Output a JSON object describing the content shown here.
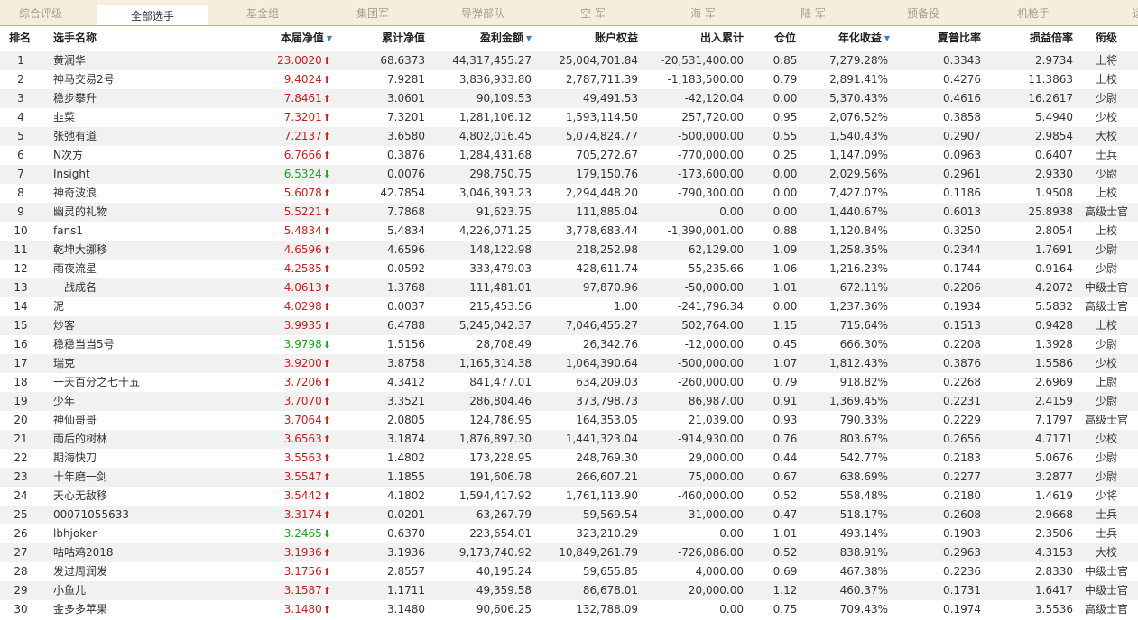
{
  "tabs": [
    {
      "label": "综合评级",
      "active": false
    },
    {
      "label": "全部选手",
      "active": true
    },
    {
      "label": "基金组",
      "active": false
    },
    {
      "label": "集团军",
      "active": false
    },
    {
      "label": "导弹部队",
      "active": false
    },
    {
      "label": "空  军",
      "active": false
    },
    {
      "label": "海  军",
      "active": false
    },
    {
      "label": "陆  军",
      "active": false
    },
    {
      "label": "预备役",
      "active": false
    },
    {
      "label": "机枪手",
      "active": false
    },
    {
      "label": "远征",
      "active": false
    }
  ],
  "columns": [
    "排名",
    "选手名称",
    "本届净值",
    "累计净值",
    "盈利金额",
    "账户权益",
    "出入累计",
    "仓位",
    "年化收益",
    "夏普比率",
    "损益倍率",
    "衔级"
  ],
  "sort_icon": "▼",
  "colors": {
    "up": "#c81e1e",
    "down": "#1aa51a",
    "sort": "#3d7ac0"
  },
  "rows": [
    {
      "rank": "1",
      "name": "黄润华",
      "nav": "23.0020",
      "dir": "up",
      "cum": "68.6373",
      "profit": "44,317,455.27",
      "equity": "25,004,701.84",
      "flow": "-20,531,400.00",
      "pos": "0.85",
      "annual": "7,279.28%",
      "sharpe": "0.3343",
      "pl": "2.9734",
      "grade": "上将"
    },
    {
      "rank": "2",
      "name": "神马交易2号",
      "nav": "9.4024",
      "dir": "up",
      "cum": "7.9281",
      "profit": "3,836,933.80",
      "equity": "2,787,711.39",
      "flow": "-1,183,500.00",
      "pos": "0.79",
      "annual": "2,891.41%",
      "sharpe": "0.4276",
      "pl": "11.3863",
      "grade": "上校"
    },
    {
      "rank": "3",
      "name": "稳步攀升",
      "nav": "7.8461",
      "dir": "up",
      "cum": "3.0601",
      "profit": "90,109.53",
      "equity": "49,491.53",
      "flow": "-42,120.04",
      "pos": "0.00",
      "annual": "5,370.43%",
      "sharpe": "0.4616",
      "pl": "16.2617",
      "grade": "少尉"
    },
    {
      "rank": "4",
      "name": "韭菜",
      "nav": "7.3201",
      "dir": "up",
      "cum": "7.3201",
      "profit": "1,281,106.12",
      "equity": "1,593,114.50",
      "flow": "257,720.00",
      "pos": "0.95",
      "annual": "2,076.52%",
      "sharpe": "0.3858",
      "pl": "5.4940",
      "grade": "少校"
    },
    {
      "rank": "5",
      "name": "张弛有道",
      "nav": "7.2137",
      "dir": "up",
      "cum": "3.6580",
      "profit": "4,802,016.45",
      "equity": "5,074,824.77",
      "flow": "-500,000.00",
      "pos": "0.55",
      "annual": "1,540.43%",
      "sharpe": "0.2907",
      "pl": "2.9854",
      "grade": "大校"
    },
    {
      "rank": "6",
      "name": "N次方",
      "nav": "6.7666",
      "dir": "up",
      "cum": "0.3876",
      "profit": "1,284,431.68",
      "equity": "705,272.67",
      "flow": "-770,000.00",
      "pos": "0.25",
      "annual": "1,147.09%",
      "sharpe": "0.0963",
      "pl": "0.6407",
      "grade": "士兵"
    },
    {
      "rank": "7",
      "name": "Insight",
      "nav": "6.5324",
      "dir": "down",
      "cum": "0.0076",
      "profit": "298,750.75",
      "equity": "179,150.76",
      "flow": "-173,600.00",
      "pos": "0.00",
      "annual": "2,029.56%",
      "sharpe": "0.2961",
      "pl": "2.9330",
      "grade": "少尉"
    },
    {
      "rank": "8",
      "name": "神奇波浪",
      "nav": "5.6078",
      "dir": "up",
      "cum": "42.7854",
      "profit": "3,046,393.23",
      "equity": "2,294,448.20",
      "flow": "-790,300.00",
      "pos": "0.00",
      "annual": "7,427.07%",
      "sharpe": "0.1186",
      "pl": "1.9508",
      "grade": "上校"
    },
    {
      "rank": "9",
      "name": "幽灵的礼物",
      "nav": "5.5221",
      "dir": "up",
      "cum": "7.7868",
      "profit": "91,623.75",
      "equity": "111,885.04",
      "flow": "0.00",
      "pos": "0.00",
      "annual": "1,440.67%",
      "sharpe": "0.6013",
      "pl": "25.8938",
      "grade": "高级士官"
    },
    {
      "rank": "10",
      "name": "fans1",
      "nav": "5.4834",
      "dir": "up",
      "cum": "5.4834",
      "profit": "4,226,071.25",
      "equity": "3,778,683.44",
      "flow": "-1,390,001.00",
      "pos": "0.88",
      "annual": "1,120.84%",
      "sharpe": "0.3250",
      "pl": "2.8054",
      "grade": "上校"
    },
    {
      "rank": "11",
      "name": "乾坤大挪移",
      "nav": "4.6596",
      "dir": "up",
      "cum": "4.6596",
      "profit": "148,122.98",
      "equity": "218,252.98",
      "flow": "62,129.00",
      "pos": "1.09",
      "annual": "1,258.35%",
      "sharpe": "0.2344",
      "pl": "1.7691",
      "grade": "少尉"
    },
    {
      "rank": "12",
      "name": "雨夜流星",
      "nav": "4.2585",
      "dir": "up",
      "cum": "0.0592",
      "profit": "333,479.03",
      "equity": "428,611.74",
      "flow": "55,235.66",
      "pos": "1.06",
      "annual": "1,216.23%",
      "sharpe": "0.1744",
      "pl": "0.9164",
      "grade": "少尉"
    },
    {
      "rank": "13",
      "name": "一战成名",
      "nav": "4.0613",
      "dir": "up",
      "cum": "1.3768",
      "profit": "111,481.01",
      "equity": "97,870.96",
      "flow": "-50,000.00",
      "pos": "1.01",
      "annual": "672.11%",
      "sharpe": "0.2206",
      "pl": "4.2072",
      "grade": "中级士官"
    },
    {
      "rank": "14",
      "name": "泥",
      "nav": "4.0298",
      "dir": "up",
      "cum": "0.0037",
      "profit": "215,453.56",
      "equity": "1.00",
      "flow": "-241,796.34",
      "pos": "0.00",
      "annual": "1,237.36%",
      "sharpe": "0.1934",
      "pl": "5.5832",
      "grade": "高级士官"
    },
    {
      "rank": "15",
      "name": "炒客",
      "nav": "3.9935",
      "dir": "up",
      "cum": "6.4788",
      "profit": "5,245,042.37",
      "equity": "7,046,455.27",
      "flow": "502,764.00",
      "pos": "1.15",
      "annual": "715.64%",
      "sharpe": "0.1513",
      "pl": "0.9428",
      "grade": "上校"
    },
    {
      "rank": "16",
      "name": "稳稳当当5号",
      "nav": "3.9798",
      "dir": "down",
      "cum": "1.5156",
      "profit": "28,708.49",
      "equity": "26,342.76",
      "flow": "-12,000.00",
      "pos": "0.45",
      "annual": "666.30%",
      "sharpe": "0.2208",
      "pl": "1.3928",
      "grade": "少尉"
    },
    {
      "rank": "17",
      "name": "瑞克",
      "nav": "3.9200",
      "dir": "up",
      "cum": "3.8758",
      "profit": "1,165,314.38",
      "equity": "1,064,390.64",
      "flow": "-500,000.00",
      "pos": "1.07",
      "annual": "1,812.43%",
      "sharpe": "0.3876",
      "pl": "1.5586",
      "grade": "少校"
    },
    {
      "rank": "18",
      "name": "一天百分之七十五",
      "nav": "3.7206",
      "dir": "up",
      "cum": "4.3412",
      "profit": "841,477.01",
      "equity": "634,209.03",
      "flow": "-260,000.00",
      "pos": "0.79",
      "annual": "918.82%",
      "sharpe": "0.2268",
      "pl": "2.6969",
      "grade": "上尉"
    },
    {
      "rank": "19",
      "name": "少年",
      "nav": "3.7070",
      "dir": "up",
      "cum": "3.3521",
      "profit": "286,804.46",
      "equity": "373,798.73",
      "flow": "86,987.00",
      "pos": "0.91",
      "annual": "1,369.45%",
      "sharpe": "0.2231",
      "pl": "2.4159",
      "grade": "少尉"
    },
    {
      "rank": "20",
      "name": "神仙哥哥",
      "nav": "3.7064",
      "dir": "up",
      "cum": "2.0805",
      "profit": "124,786.95",
      "equity": "164,353.05",
      "flow": "21,039.00",
      "pos": "0.93",
      "annual": "790.33%",
      "sharpe": "0.2229",
      "pl": "7.1797",
      "grade": "高级士官"
    },
    {
      "rank": "21",
      "name": "雨后的树林",
      "nav": "3.6563",
      "dir": "up",
      "cum": "3.1874",
      "profit": "1,876,897.30",
      "equity": "1,441,323.04",
      "flow": "-914,930.00",
      "pos": "0.76",
      "annual": "803.67%",
      "sharpe": "0.2656",
      "pl": "4.7171",
      "grade": "少校"
    },
    {
      "rank": "22",
      "name": "期海快刀",
      "nav": "3.5563",
      "dir": "up",
      "cum": "1.4802",
      "profit": "173,228.95",
      "equity": "248,769.30",
      "flow": "29,000.00",
      "pos": "0.44",
      "annual": "542.77%",
      "sharpe": "0.2183",
      "pl": "5.0676",
      "grade": "少尉"
    },
    {
      "rank": "23",
      "name": "十年磨一剑",
      "nav": "3.5547",
      "dir": "up",
      "cum": "1.1855",
      "profit": "191,606.78",
      "equity": "266,607.21",
      "flow": "75,000.00",
      "pos": "0.67",
      "annual": "638.69%",
      "sharpe": "0.2277",
      "pl": "3.2877",
      "grade": "少尉"
    },
    {
      "rank": "24",
      "name": "天心无敌移",
      "nav": "3.5442",
      "dir": "up",
      "cum": "4.1802",
      "profit": "1,594,417.92",
      "equity": "1,761,113.90",
      "flow": "-460,000.00",
      "pos": "0.52",
      "annual": "558.48%",
      "sharpe": "0.2180",
      "pl": "1.4619",
      "grade": "少将"
    },
    {
      "rank": "25",
      "name": "00071055633",
      "nav": "3.3174",
      "dir": "up",
      "cum": "0.0201",
      "profit": "63,267.79",
      "equity": "59,569.54",
      "flow": "-31,000.00",
      "pos": "0.47",
      "annual": "518.17%",
      "sharpe": "0.2608",
      "pl": "2.9668",
      "grade": "士兵"
    },
    {
      "rank": "26",
      "name": "lbhjoker",
      "nav": "3.2465",
      "dir": "down",
      "cum": "0.6370",
      "profit": "223,654.01",
      "equity": "323,210.29",
      "flow": "0.00",
      "pos": "1.01",
      "annual": "493.14%",
      "sharpe": "0.1903",
      "pl": "2.3506",
      "grade": "士兵"
    },
    {
      "rank": "27",
      "name": "咕咕鸡2018",
      "nav": "3.1936",
      "dir": "up",
      "cum": "3.1936",
      "profit": "9,173,740.92",
      "equity": "10,849,261.79",
      "flow": "-726,086.00",
      "pos": "0.52",
      "annual": "838.91%",
      "sharpe": "0.2963",
      "pl": "4.3153",
      "grade": "大校"
    },
    {
      "rank": "28",
      "name": "发过周润发",
      "nav": "3.1756",
      "dir": "up",
      "cum": "2.8557",
      "profit": "40,195.24",
      "equity": "59,655.85",
      "flow": "4,000.00",
      "pos": "0.69",
      "annual": "467.38%",
      "sharpe": "0.2236",
      "pl": "2.8330",
      "grade": "中级士官"
    },
    {
      "rank": "29",
      "name": "小鱼儿",
      "nav": "3.1587",
      "dir": "up",
      "cum": "1.1711",
      "profit": "49,359.58",
      "equity": "86,678.01",
      "flow": "20,000.00",
      "pos": "1.12",
      "annual": "460.37%",
      "sharpe": "0.1731",
      "pl": "1.6417",
      "grade": "中级士官"
    },
    {
      "rank": "30",
      "name": "金多多苹果",
      "nav": "3.1480",
      "dir": "up",
      "cum": "3.1480",
      "profit": "90,606.25",
      "equity": "132,788.09",
      "flow": "0.00",
      "pos": "0.75",
      "annual": "709.43%",
      "sharpe": "0.1974",
      "pl": "3.5536",
      "grade": "高级士官"
    }
  ]
}
